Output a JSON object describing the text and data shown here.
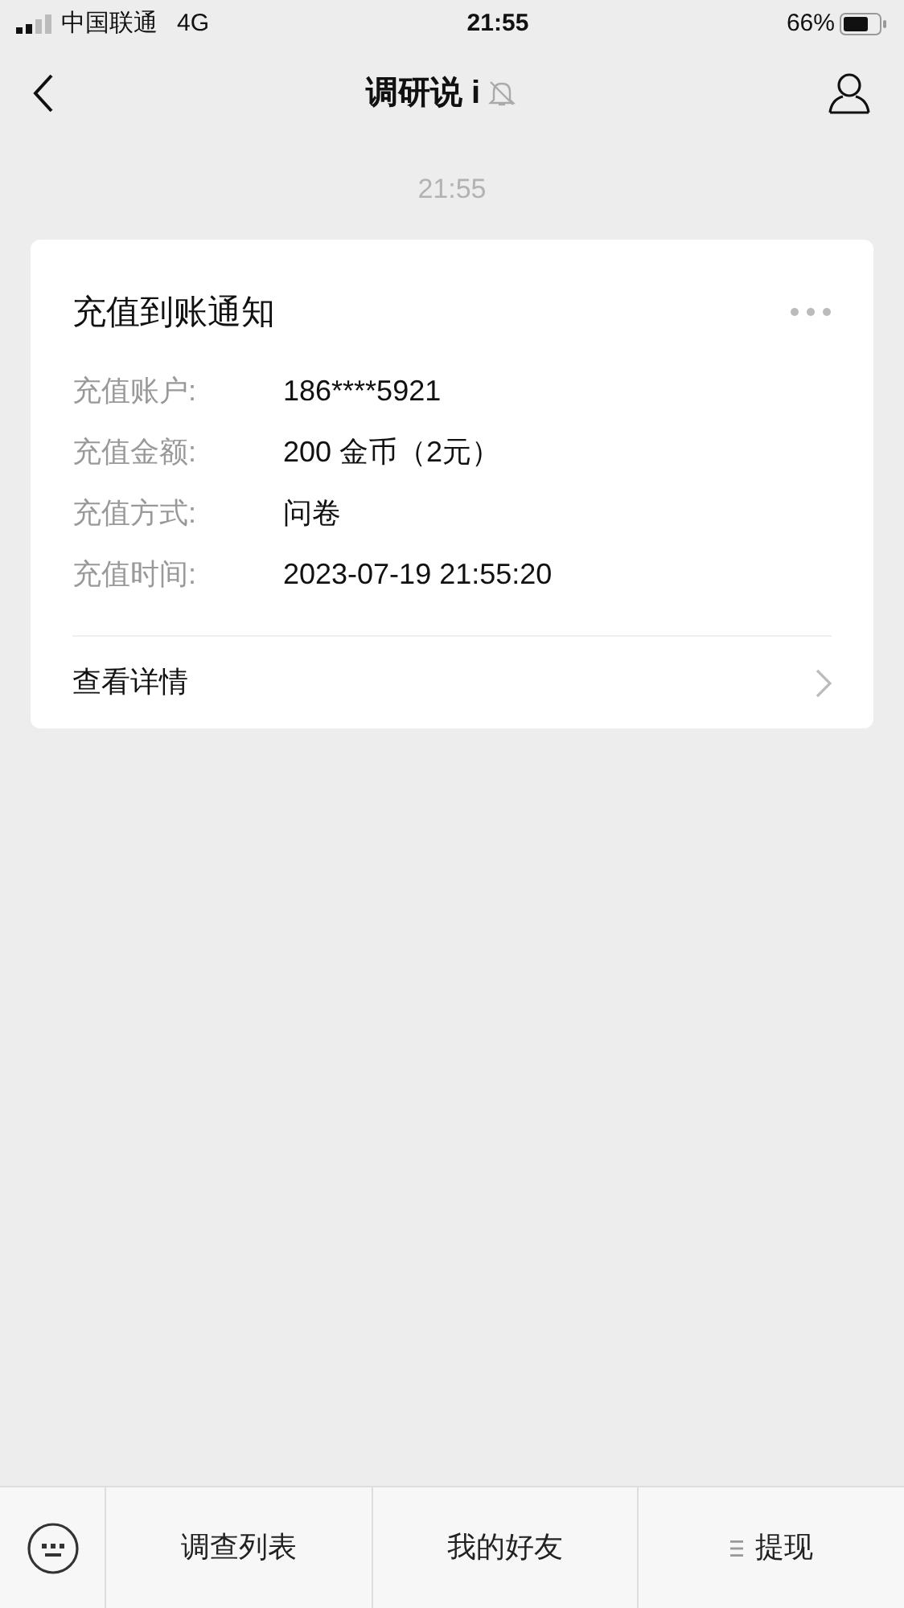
{
  "status_bar": {
    "carrier": "中国联通",
    "network": "4G",
    "time": "21:55",
    "battery": "66%"
  },
  "nav": {
    "title": "调研说 i",
    "muted": true
  },
  "timestamp": "21:55",
  "card": {
    "title": "充值到账通知",
    "fields": [
      {
        "label": "充值账户:",
        "value": "186****5921"
      },
      {
        "label": "充值金额:",
        "value": "200 金币（2元）"
      },
      {
        "label": "充值方式:",
        "value": "问卷"
      },
      {
        "label": "充值时间:",
        "value": "2023-07-19 21:55:20"
      }
    ],
    "link": "查看详情"
  },
  "menu": [
    {
      "label": "调查列表",
      "has_submenu": false
    },
    {
      "label": "我的好友",
      "has_submenu": false
    },
    {
      "label": "提现",
      "has_submenu": true
    }
  ]
}
